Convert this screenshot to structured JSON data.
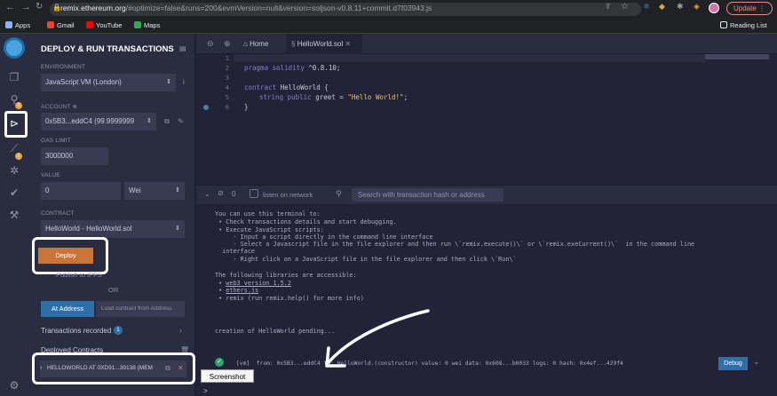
{
  "browser": {
    "url_host": "remix.ethereum.org",
    "url_rest": "/#optimize=false&runs=200&evmVersion=null&version=soljson-v0.8.11+commit.d7f03943.js",
    "update_label": "Update",
    "bookmarks": [
      "Apps",
      "Gmail",
      "YouTube",
      "Maps"
    ],
    "reading_list": "Reading List"
  },
  "panel": {
    "title": "DEPLOY & RUN TRANSACTIONS",
    "environment_label": "ENVIRONMENT",
    "environment_value": "JavaScript VM (London)",
    "account_label": "ACCOUNT",
    "account_value": "0x5B3...eddC4 (99.9999999",
    "gas_limit_label": "GAS LIMIT",
    "gas_limit_value": "3000000",
    "value_label": "VALUE",
    "value_amount": "0",
    "value_unit": "Wei",
    "contract_label": "CONTRACT",
    "contract_value": "HelloWorld - HelloWorld.sol",
    "deploy_label": "Deploy",
    "publish_label": "Publish to IPFS",
    "or_label": "OR",
    "at_address_label": "At Address",
    "load_contract_placeholder": "Load contract from Address",
    "transactions_recorded_label": "Transactions recorded",
    "transactions_recorded_count": "1",
    "deployed_contracts_label": "Deployed Contracts",
    "deployed_instance": "HELLOWORLD AT 0XD91...39138 (MEM"
  },
  "iconbar": {
    "badge_a": "1",
    "badge_b": "1"
  },
  "editor": {
    "home_tab": "Home",
    "file_tab": "HelloWorld.sol",
    "line_numbers": [
      "1",
      "2",
      "3",
      "4",
      "5",
      "6"
    ],
    "lines": {
      "l2_kw": "pragma solidity",
      "l2_rest": " ^0.8.10;",
      "l4_kw": "contract",
      "l4_rest": " HelloWorld {",
      "l5_kw": "string public",
      "l5_mid": " greet = ",
      "l5_str": "\"Hello World!\"",
      "l5_end": ";",
      "l6": "}"
    }
  },
  "terminal": {
    "zero_count": "0",
    "listen_label": "listen on network",
    "search_placeholder": "Search with transaction hash or address",
    "intro": [
      "You can use this terminal to:",
      " • Check transactions details and start debugging.",
      " • Execute JavaScript scripts:",
      "     - Input a script directly in the command line interface",
      "     - Select a Javascript file in the file explorer and then run \\`remix.execute()\\` or \\`remix.exeCurrent()\\`  in the command line",
      "  interface",
      "     - Right click on a JavaScript file in the file explorer and then click \\`Run\\`"
    ],
    "libs_title": "The following libraries are accessible:",
    "lib_web3": "web3 version 1.5.2",
    "lib_ethers": "ethers.js",
    "lib_remix": "remix (run remix.help() for more info)",
    "pending": "creation of HelloWorld pending...",
    "tx_line": "[vm]  from: 0x5B3...eddC4 to: HelloWorld.(constructor) value: 0 wei data: 0x608...b0033 logs: 0 hash: 0x4ef...429f4",
    "debug_label": "Debug",
    "prompt": ">",
    "tooltip": "Screenshot"
  },
  "colors": {
    "accent": "#c97539",
    "panel_bg": "#2a2c3f",
    "editor_bg": "#222336",
    "debug_blue": "#2d6fa8"
  }
}
